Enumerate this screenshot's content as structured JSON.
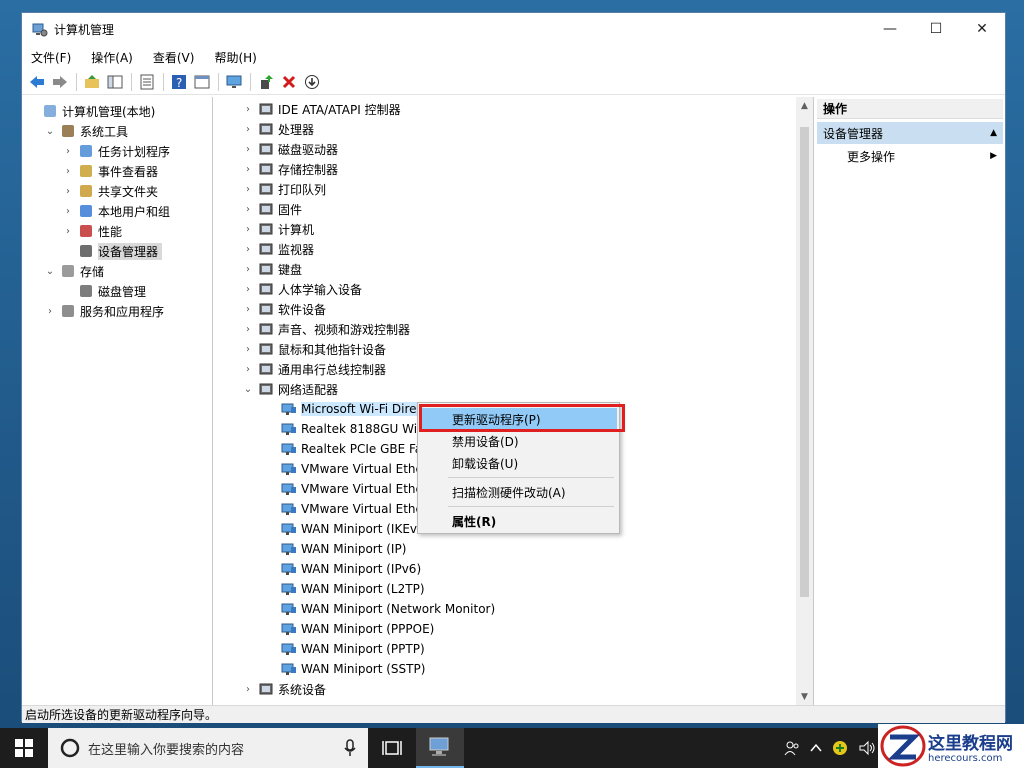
{
  "window": {
    "title": "计算机管理"
  },
  "controls": {
    "minimize": "—",
    "maximize": "☐",
    "close": "✕"
  },
  "menu": [
    "文件(F)",
    "操作(A)",
    "查看(V)",
    "帮助(H)"
  ],
  "left_tree": [
    {
      "label": "计算机管理(本地)",
      "level": 0,
      "arrow": ""
    },
    {
      "label": "系统工具",
      "level": 1,
      "arrow": "⌄"
    },
    {
      "label": "任务计划程序",
      "level": 2,
      "arrow": "›"
    },
    {
      "label": "事件查看器",
      "level": 2,
      "arrow": "›"
    },
    {
      "label": "共享文件夹",
      "level": 2,
      "arrow": "›"
    },
    {
      "label": "本地用户和组",
      "level": 2,
      "arrow": "›"
    },
    {
      "label": "性能",
      "level": 2,
      "arrow": "›"
    },
    {
      "label": "设备管理器",
      "level": 2,
      "arrow": "",
      "selected": true
    },
    {
      "label": "存储",
      "level": 1,
      "arrow": "⌄"
    },
    {
      "label": "磁盘管理",
      "level": 2,
      "arrow": ""
    },
    {
      "label": "服务和应用程序",
      "level": 1,
      "arrow": "›"
    }
  ],
  "device_tree": [
    {
      "label": "IDE ATA/ATAPI 控制器",
      "child": false,
      "expanded": false
    },
    {
      "label": "处理器",
      "child": false,
      "expanded": false
    },
    {
      "label": "磁盘驱动器",
      "child": false,
      "expanded": false
    },
    {
      "label": "存储控制器",
      "child": false,
      "expanded": false
    },
    {
      "label": "打印队列",
      "child": false,
      "expanded": false
    },
    {
      "label": "固件",
      "child": false,
      "expanded": false
    },
    {
      "label": "计算机",
      "child": false,
      "expanded": false
    },
    {
      "label": "监视器",
      "child": false,
      "expanded": false
    },
    {
      "label": "键盘",
      "child": false,
      "expanded": false
    },
    {
      "label": "人体学输入设备",
      "child": false,
      "expanded": false
    },
    {
      "label": "软件设备",
      "child": false,
      "expanded": false
    },
    {
      "label": "声音、视频和游戏控制器",
      "child": false,
      "expanded": false
    },
    {
      "label": "鼠标和其他指针设备",
      "child": false,
      "expanded": false
    },
    {
      "label": "通用串行总线控制器",
      "child": false,
      "expanded": false
    },
    {
      "label": "网络适配器",
      "child": false,
      "expanded": true
    },
    {
      "label": "Microsoft Wi-Fi Direc",
      "child": true,
      "selected": true
    },
    {
      "label": "Realtek 8188GU Wire",
      "child": true
    },
    {
      "label": "Realtek PCIe GBE Fa",
      "child": true
    },
    {
      "label": "VMware Virtual Ethe",
      "child": true
    },
    {
      "label": "VMware Virtual Ethe",
      "child": true
    },
    {
      "label": "VMware Virtual Ethe",
      "child": true
    },
    {
      "label": "WAN Miniport (IKEv",
      "child": true
    },
    {
      "label": "WAN Miniport (IP)",
      "child": true
    },
    {
      "label": "WAN Miniport (IPv6)",
      "child": true
    },
    {
      "label": "WAN Miniport (L2TP)",
      "child": true
    },
    {
      "label": "WAN Miniport (Network Monitor)",
      "child": true
    },
    {
      "label": "WAN Miniport (PPPOE)",
      "child": true
    },
    {
      "label": "WAN Miniport (PPTP)",
      "child": true
    },
    {
      "label": "WAN Miniport (SSTP)",
      "child": true
    },
    {
      "label": "系统设备",
      "child": false,
      "expanded": false
    }
  ],
  "context_menu": {
    "update_driver": "更新驱动程序(P)",
    "disable": "禁用设备(D)",
    "uninstall": "卸载设备(U)",
    "scan": "扫描检测硬件改动(A)",
    "properties": "属性(R)"
  },
  "actions": {
    "header": "操作",
    "section": "设备管理器",
    "more": "更多操作"
  },
  "status_text": "启动所选设备的更新驱动程序向导。",
  "taskbar": {
    "search_placeholder": "在这里输入你要搜索的内容"
  },
  "watermark": {
    "cn": "这里教程网",
    "en": "herecours.com"
  },
  "colors": {
    "accent": "#91c9f7",
    "highlight_border": "#e02020",
    "watermark_blue": "#1a3e8c"
  }
}
